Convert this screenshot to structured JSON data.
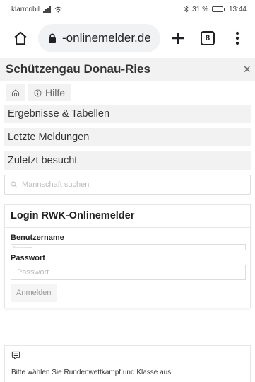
{
  "statusbar": {
    "carrier": "klarmobil",
    "battery_percent": "31 %",
    "battery_level": 0.31,
    "time": "13:44"
  },
  "browser": {
    "url": "-onlinemelder.de",
    "tab_count": "8"
  },
  "page": {
    "title": "Schützengau Donau-Ries",
    "close_label": "×",
    "breadcrumb": {
      "help_label": "Hilfe"
    },
    "menu": [
      {
        "label": "Ergebnisse & Tabellen"
      },
      {
        "label": "Letzte Meldungen"
      },
      {
        "label": "Zuletzt besucht"
      }
    ],
    "search": {
      "placeholder": "Mannschaft suchen"
    }
  },
  "login": {
    "title": "Login RWK-Onlinemelder",
    "username_label": "Benutzername",
    "username_placeholder": "Benutzername",
    "password_label": "Passwort",
    "password_placeholder": "Passwort",
    "submit_label": "Anmelden"
  },
  "info": {
    "text": "Bitte wählen Sie Rundenwettkampf und Klasse aus."
  }
}
